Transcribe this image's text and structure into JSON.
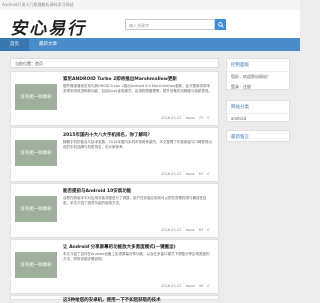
{
  "topbar": {
    "text": "Android开发人门原理解析源码学习网站"
  },
  "header": {
    "logo": "安心易行",
    "search_placeholder": "输入关键字"
  },
  "nav": [
    {
      "label": "首页"
    },
    {
      "label": "最新文章"
    }
  ],
  "breadcrumb": "当前位置：首页",
  "thumb_label": "没有图一样精彩",
  "posts": [
    {
      "title": "索尼ANDROID Turbo 2即将推出Marshmallow更新",
      "excerpt": "据外媒报道索尼将为其DROID Turbo 2推出Android 6.0 Marshmallow更新。此次更新将带来多项系统改进和新功能，包括Doze省电模式、应用权限管理等，提升设备的流畅度与续航表现。",
      "date": "2016-03-22",
      "author": "zippo",
      "views": "79",
      "comments": "0"
    },
    {
      "title": "2015年国内十大八大手机排名，你了解吗？",
      "excerpt": "随着手机的普及与技术发展，2015年国内手机市场竞争激烈。本文整理了年度销量与口碑表现出色的手机品牌与机型排名，供大家参考。",
      "date": "2016-03-22",
      "author": "zippo",
      "views": "62",
      "comments": "0"
    },
    {
      "title": "能否提前与Android 10安装功能",
      "excerpt": "谷歌在新版本中对应用安装流程进行了调整，用户在安装应用前可以预先查看权限与兼容性信息，本文介绍了相关功能的使用方法。",
      "date": "2016-03-22",
      "author": "zippo",
      "views": "63",
      "comments": "0"
    },
    {
      "title": "让 Android 分享屏幕的功能放大多宽度模式(一键搬运)",
      "excerpt": "本文介绍了如何在Android设备上实现屏幕分享功能，以及在多窗口模式下调整分享区域宽度的方法，附带详细步骤说明。",
      "date": "2016-03-22",
      "author": "zippo",
      "views": "40",
      "comments": "0"
    },
    {
      "title": "这5种给您的安卓机，使用一下不如您获取的技术",
      "excerpt": "",
      "date": "",
      "author": "",
      "views": "",
      "comments": ""
    }
  ],
  "sidebar": {
    "boxes": [
      {
        "title": "控制面板",
        "lines": [
          "您好，欢迎到访网站！",
          "登录 · 注册"
        ]
      },
      {
        "title": "网站分类",
        "lines": [
          "android"
        ]
      },
      {
        "title": "最新留言",
        "lines": []
      }
    ]
  },
  "colors": {
    "accent": "#4a8bc9",
    "accent_dark": "#3a78b3"
  }
}
